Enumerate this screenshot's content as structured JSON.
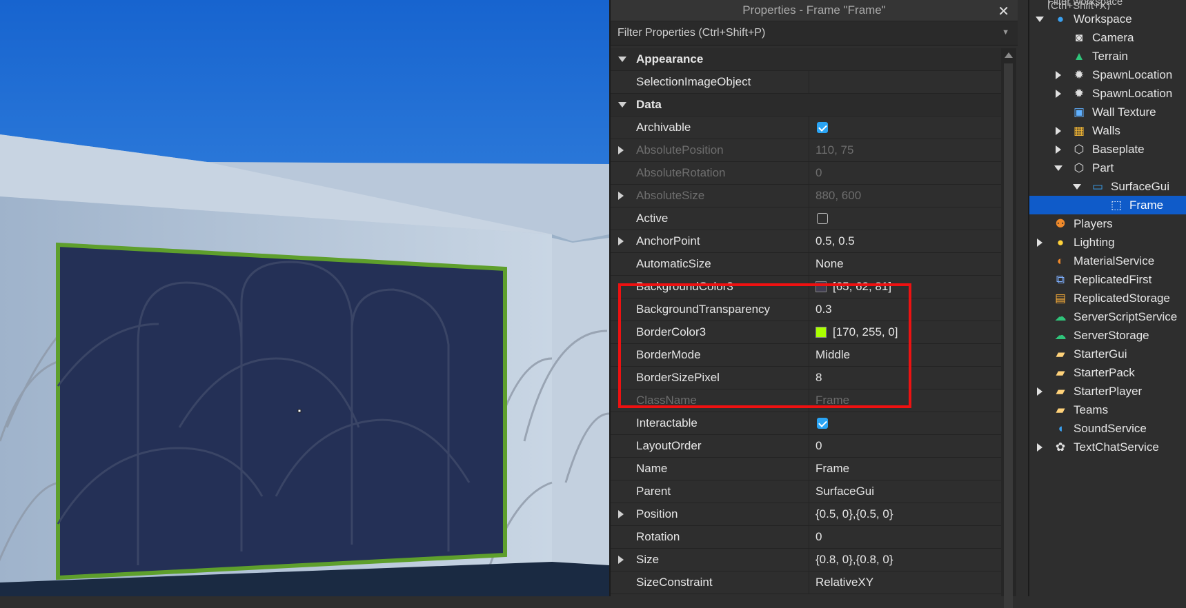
{
  "viewport": {
    "frame_fill": "#243056",
    "frame_border": "#5e9f2c",
    "sky_top": "#1d6fd8",
    "sky_bottom": "#5aa8f0",
    "wall": "#aebfd4"
  },
  "properties": {
    "title": "Properties - Frame \"Frame\"",
    "close": "✕",
    "filter_placeholder": "Filter Properties (Ctrl+Shift+P)",
    "categories": {
      "appearance": "Appearance",
      "data": "Data"
    },
    "rows": [
      {
        "name": "SelectionImageObject",
        "value": ""
      },
      {
        "name": "Archivable",
        "value": "",
        "checkbox": true
      },
      {
        "name": "AbsolutePosition",
        "value": "110, 75"
      },
      {
        "name": "AbsoluteRotation",
        "value": "0"
      },
      {
        "name": "AbsoluteSize",
        "value": "880, 600"
      },
      {
        "name": "Active",
        "value": "",
        "checkbox": false
      },
      {
        "name": "AnchorPoint",
        "value": "0.5, 0.5"
      },
      {
        "name": "AutomaticSize",
        "value": "None"
      },
      {
        "name": "BackgroundColor3",
        "value": "[65, 62, 81]",
        "swatch": "#413e51"
      },
      {
        "name": "BackgroundTransparency",
        "value": "0.3"
      },
      {
        "name": "BorderColor3",
        "value": "[170, 255, 0]",
        "swatch": "#aaff00"
      },
      {
        "name": "BorderMode",
        "value": "Middle"
      },
      {
        "name": "BorderSizePixel",
        "value": "8"
      },
      {
        "name": "ClassName",
        "value": "Frame"
      },
      {
        "name": "Interactable",
        "value": "",
        "checkbox": true
      },
      {
        "name": "LayoutOrder",
        "value": "0"
      },
      {
        "name": "Name",
        "value": "Frame"
      },
      {
        "name": "Parent",
        "value": "SurfaceGui"
      },
      {
        "name": "Position",
        "value": "{0.5, 0},{0.5, 0}"
      },
      {
        "name": "Rotation",
        "value": "0"
      },
      {
        "name": "Size",
        "value": "{0.8, 0},{0.8, 0}"
      },
      {
        "name": "SizeConstraint",
        "value": "RelativeXY"
      }
    ],
    "highlight_color": "#ee1111"
  },
  "explorer": {
    "filter_placeholder": "Filter workspace (Ctrl+Shift+X)",
    "items": [
      {
        "label": "Workspace",
        "icon": "globe-icon"
      },
      {
        "label": "Camera",
        "icon": "camera-icon"
      },
      {
        "label": "Terrain",
        "icon": "terrain-icon"
      },
      {
        "label": "SpawnLocation",
        "icon": "gear-icon"
      },
      {
        "label": "SpawnLocation",
        "icon": "gear-icon"
      },
      {
        "label": "Wall Texture",
        "icon": "texture-icon"
      },
      {
        "label": "Walls",
        "icon": "model-icon"
      },
      {
        "label": "Baseplate",
        "icon": "part-icon"
      },
      {
        "label": "Part",
        "icon": "part-icon"
      },
      {
        "label": "SurfaceGui",
        "icon": "surfacegui-icon"
      },
      {
        "label": "Frame",
        "icon": "frame-icon"
      },
      {
        "label": "Players",
        "icon": "players-icon"
      },
      {
        "label": "Lighting",
        "icon": "bulb-icon"
      },
      {
        "label": "MaterialService",
        "icon": "material-icon"
      },
      {
        "label": "ReplicatedFirst",
        "icon": "replicated-first-icon"
      },
      {
        "label": "ReplicatedStorage",
        "icon": "replicated-storage-icon"
      },
      {
        "label": "ServerScriptService",
        "icon": "server-script-icon"
      },
      {
        "label": "ServerStorage",
        "icon": "server-storage-icon"
      },
      {
        "label": "StarterGui",
        "icon": "starter-gui-icon"
      },
      {
        "label": "StarterPack",
        "icon": "starter-pack-icon"
      },
      {
        "label": "StarterPlayer",
        "icon": "starter-player-icon"
      },
      {
        "label": "Teams",
        "icon": "teams-icon"
      },
      {
        "label": "SoundService",
        "icon": "sound-icon"
      },
      {
        "label": "TextChatService",
        "icon": "chat-icon"
      }
    ]
  }
}
